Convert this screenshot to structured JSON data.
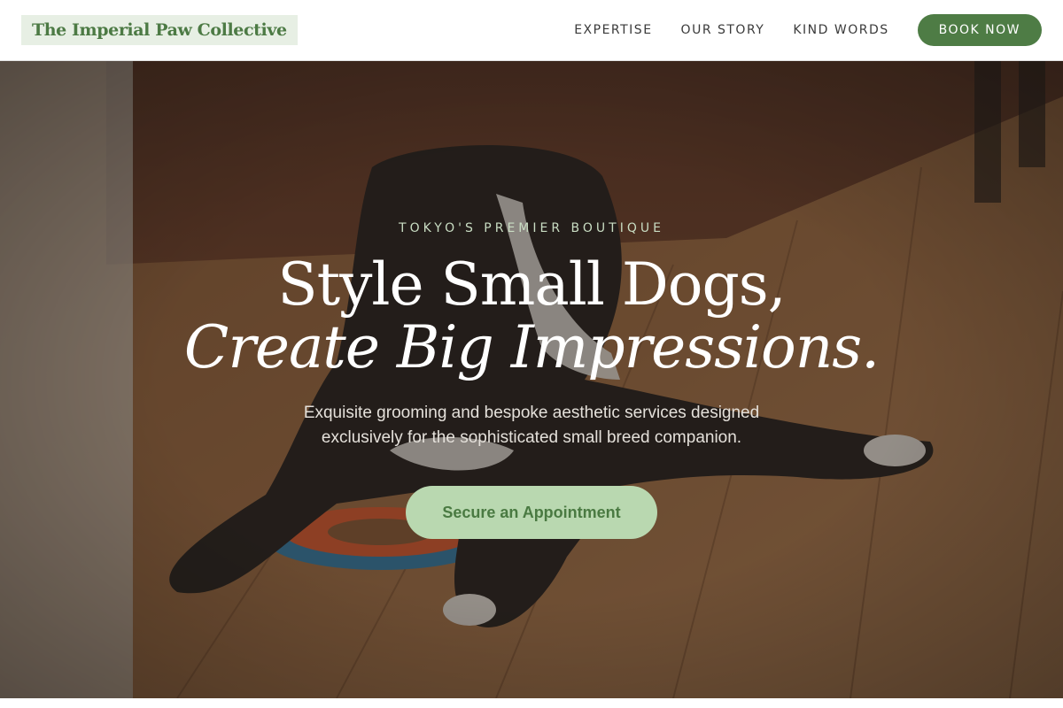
{
  "header": {
    "logo": "The Imperial Paw Collective",
    "nav": [
      {
        "label": "EXPERTISE"
      },
      {
        "label": "OUR STORY"
      },
      {
        "label": "KIND WORDS"
      }
    ],
    "cta": "BOOK NOW"
  },
  "hero": {
    "eyebrow": "TOKYO'S PREMIER BOUTIQUE",
    "headline_line1": "Style Small Dogs,",
    "headline_line2": "Create Big Impressions.",
    "subtext_line1": "Exquisite grooming and bespoke aesthetic services designed",
    "subtext_line2": "exclusively for the sophisticated small breed companion.",
    "cta": "Secure an Appointment",
    "background_image": "dog-on-wooden-floor-photo"
  },
  "colors": {
    "brand_green": "#4e7c45",
    "logo_bg": "#e7efe4",
    "cta_light_green": "#b9d8b0",
    "eyebrow": "#c9ddc3"
  }
}
